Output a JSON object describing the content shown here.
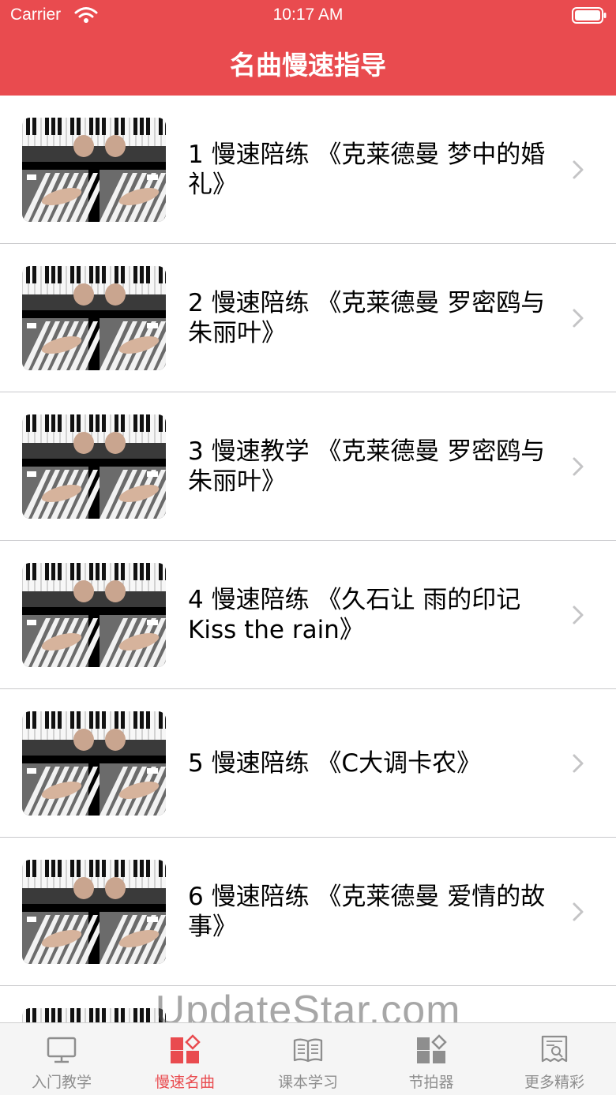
{
  "status_bar": {
    "carrier": "Carrier",
    "time": "10:17 AM"
  },
  "nav": {
    "title": "名曲慢速指导"
  },
  "items": [
    {
      "title": "1  慢速陪练 《克莱德曼 梦中的婚礼》"
    },
    {
      "title": "2  慢速陪练 《克莱德曼 罗密鸥与朱丽叶》"
    },
    {
      "title": "3  慢速教学 《克莱德曼 罗密鸥与朱丽叶》"
    },
    {
      "title": "4  慢速陪练 《久石让 雨的印记 Kiss the rain》"
    },
    {
      "title": "5  慢速陪练 《C大调卡农》"
    },
    {
      "title": "6  慢速陪练 《克莱德曼 爱情的故事》"
    },
    {
      "title": ""
    }
  ],
  "watermark": "UpdateStar.com",
  "tabs": [
    {
      "label": "入门教学",
      "icon": "monitor-icon",
      "active": false
    },
    {
      "label": "慢速名曲",
      "icon": "blocks-icon",
      "active": true
    },
    {
      "label": "课本学习",
      "icon": "open-book-icon",
      "active": false
    },
    {
      "label": "节拍器",
      "icon": "blocks-icon",
      "active": false
    },
    {
      "label": "更多精彩",
      "icon": "certificate-icon",
      "active": false
    }
  ],
  "colors": {
    "accent": "#e94b4f",
    "inactive": "#8e8e8e",
    "separator": "#c9c9cc"
  }
}
